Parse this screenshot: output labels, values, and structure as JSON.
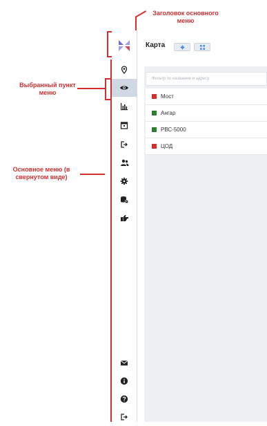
{
  "annotations": {
    "header_label": "Заголовок основного меню",
    "selected_label": "Выбранный пункт меню",
    "menu_label": "Основное меню (в свернутом виде)",
    "color": "#d32f2f"
  },
  "sidebar": {
    "logo_icon": "app-logo",
    "items": [
      {
        "icon": "location-pin-icon"
      },
      {
        "icon": "eye-icon",
        "selected": true
      },
      {
        "icon": "bar-chart-icon"
      },
      {
        "icon": "calendar-icon"
      },
      {
        "icon": "sign-out-icon"
      },
      {
        "icon": "users-icon"
      },
      {
        "icon": "gear-icon"
      },
      {
        "icon": "database-settings-icon"
      },
      {
        "icon": "hand-pointer-icon"
      }
    ],
    "bottom_items": [
      {
        "icon": "envelope-icon"
      },
      {
        "icon": "info-icon"
      },
      {
        "icon": "help-icon"
      },
      {
        "icon": "logout-icon"
      }
    ]
  },
  "main": {
    "title": "Карта",
    "toolbar": [
      {
        "icon": "gear-small-icon"
      },
      {
        "icon": "grid-icon"
      }
    ],
    "filter_placeholder": "Фильтр по названию и адресу",
    "objects": [
      {
        "name": "Мост",
        "color": "#d32f2f"
      },
      {
        "name": "Ангар",
        "color": "#2e7d32"
      },
      {
        "name": "РВС-5000",
        "color": "#2e7d32"
      },
      {
        "name": "ЦОД",
        "color": "#d32f2f"
      }
    ]
  }
}
